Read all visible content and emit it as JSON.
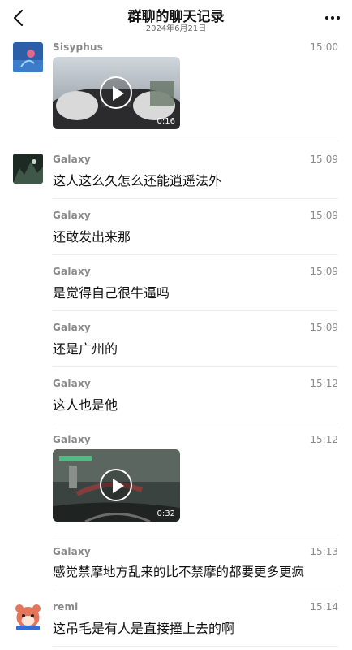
{
  "header": {
    "title": "群聊的聊天记录",
    "date": "2024年6月21日"
  },
  "messages": [
    {
      "sender": "Sisyphus",
      "time": "15:00",
      "type": "video",
      "duration": "0:16"
    },
    {
      "sender": "Galaxy",
      "time": "15:09",
      "type": "text",
      "text": "这人这么久怎么还能逍遥法外"
    },
    {
      "sender": "Galaxy",
      "time": "15:09",
      "type": "text",
      "text": "还敢发出来那"
    },
    {
      "sender": "Galaxy",
      "time": "15:09",
      "type": "text",
      "text": "是觉得自己很牛逼吗"
    },
    {
      "sender": "Galaxy",
      "time": "15:09",
      "type": "text",
      "text": "还是广州的"
    },
    {
      "sender": "Galaxy",
      "time": "15:12",
      "type": "text",
      "text": "这人也是他"
    },
    {
      "sender": "Galaxy",
      "time": "15:12",
      "type": "video",
      "duration": "0:32"
    },
    {
      "sender": "Galaxy",
      "time": "15:13",
      "type": "text",
      "text": "感觉禁摩地方乱来的比不禁摩的都要更多更疯"
    },
    {
      "sender": "remi",
      "time": "15:14",
      "type": "text",
      "text": "这吊毛是有人是直接撞上去的啊"
    }
  ],
  "icons": {
    "back": "chevron-left-icon",
    "more": "more-dots-icon",
    "play": "play-icon"
  }
}
